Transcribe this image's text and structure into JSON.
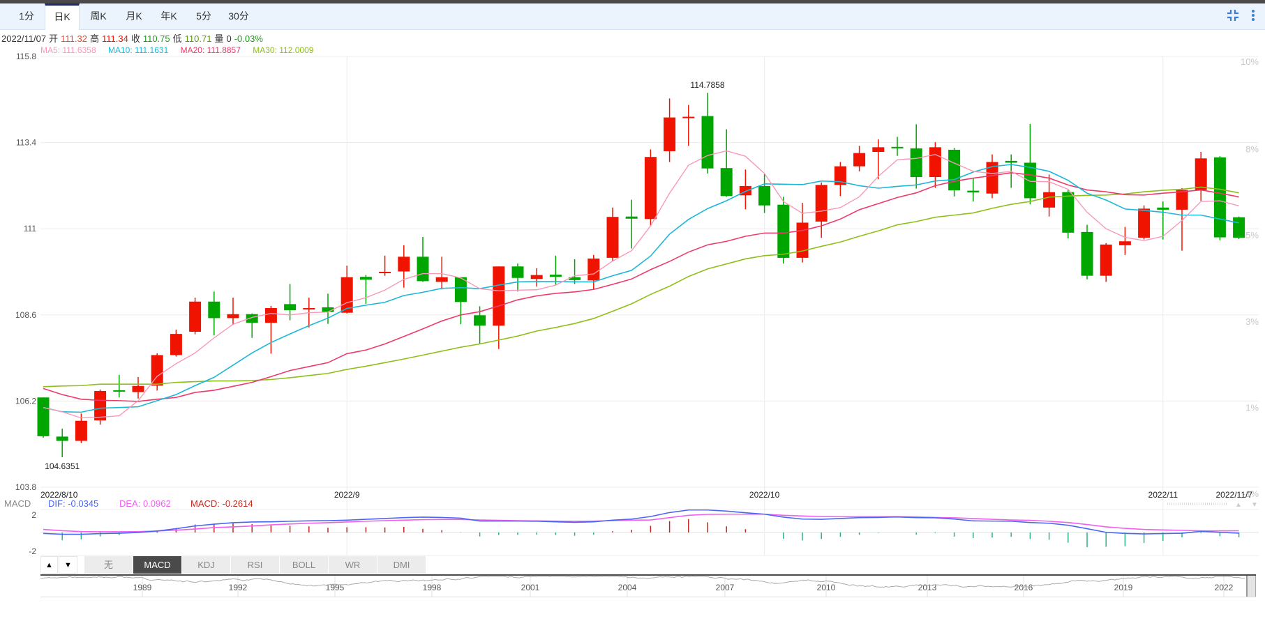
{
  "tabs": [
    {
      "label": "1分"
    },
    {
      "label": "日K",
      "active": true
    },
    {
      "label": "周K"
    },
    {
      "label": "月K"
    },
    {
      "label": "年K"
    },
    {
      "label": "5分"
    },
    {
      "label": "30分"
    }
  ],
  "toolbar": {
    "collapse_icon": "compress-icon",
    "more_icon": "more-vertical-icon"
  },
  "info": {
    "date": "2022/11/07",
    "open_label": "开",
    "open": "111.32",
    "high_label": "高",
    "high": "111.34",
    "close_label": "收",
    "close": "110.75",
    "low_label": "低",
    "low": "110.71",
    "volume_label": "量",
    "volume": "0",
    "change": "-0.03%"
  },
  "ma_legend": {
    "ma5": "MA5: 111.6358",
    "ma10": "MA10: 111.1631",
    "ma20": "MA20: 111.8857",
    "ma30": "MA30: 112.0009"
  },
  "macd_legend": {
    "title": "MACD",
    "dif": "DIF: -0.0345",
    "dea": "DEA: 0.0962",
    "macd": "MACD: -0.2614"
  },
  "indicator_tabs": [
    {
      "label": "无"
    },
    {
      "label": "MACD",
      "active": true
    },
    {
      "label": "KDJ"
    },
    {
      "label": "RSI"
    },
    {
      "label": "BOLL"
    },
    {
      "label": "WR"
    },
    {
      "label": "DMI"
    }
  ],
  "indicator_arrows": {
    "up": "▲",
    "down": "▼"
  },
  "navigator": {
    "years": [
      "1989",
      "1992",
      "1995",
      "1998",
      "2001",
      "2004",
      "2007",
      "2010",
      "2013",
      "2016",
      "2019",
      "2022"
    ]
  },
  "colors": {
    "up": "#f01400",
    "down": "#00a600",
    "ma5": "#f799b8",
    "ma10": "#1ab8d8",
    "ma20": "#ee3a6a",
    "ma30": "#8fbf1a",
    "dif": "#4a66f5",
    "dea": "#f060f0",
    "hist_up": "#c0281e",
    "hist_down": "#2ab38a"
  },
  "chart_data": {
    "type": "candlestick",
    "price_axis": {
      "ticks": [
        "115.8",
        "113.4",
        "111",
        "108.6",
        "106.2",
        "103.8"
      ],
      "range": [
        103.8,
        115.8
      ]
    },
    "percent_axis": {
      "ticks": [
        "10%",
        "8%",
        "5%",
        "3%",
        "1%",
        "-1%"
      ]
    },
    "date_labels": [
      {
        "text": "2022/8/10",
        "index": 0
      },
      {
        "text": "2022/9",
        "index": 16
      },
      {
        "text": "2022/10",
        "index": 38
      },
      {
        "text": "2022/11",
        "index": 59
      },
      {
        "text": "2022/11/7",
        "index": 63
      }
    ],
    "annotations": [
      {
        "text": "104.6351",
        "index": 1,
        "pos": "below"
      },
      {
        "text": "114.7858",
        "index": 35,
        "pos": "above"
      }
    ],
    "ohlc": [
      [
        106.3,
        106.3,
        105.18,
        105.22
      ],
      [
        105.21,
        105.43,
        104.6351,
        105.09
      ],
      [
        105.09,
        105.85,
        105.03,
        105.65
      ],
      [
        105.66,
        106.52,
        105.54,
        106.48
      ],
      [
        106.5,
        106.93,
        106.3,
        106.47
      ],
      [
        106.45,
        106.87,
        106.27,
        106.62
      ],
      [
        106.63,
        107.53,
        106.49,
        107.48
      ],
      [
        107.48,
        108.19,
        107.44,
        108.07
      ],
      [
        108.13,
        109.08,
        108.06,
        108.97
      ],
      [
        108.97,
        109.25,
        108.03,
        108.51
      ],
      [
        108.51,
        109.08,
        108.32,
        108.62
      ],
      [
        108.62,
        108.64,
        107.96,
        108.38
      ],
      [
        108.38,
        108.85,
        107.52,
        108.79
      ],
      [
        108.9,
        109.46,
        108.45,
        108.73
      ],
      [
        108.75,
        109.08,
        108.25,
        108.79
      ],
      [
        108.81,
        109.19,
        108.35,
        108.68
      ],
      [
        108.66,
        109.97,
        108.64,
        109.65
      ],
      [
        109.66,
        109.71,
        108.91,
        109.58
      ],
      [
        109.78,
        110.25,
        109.69,
        109.8
      ],
      [
        109.81,
        110.54,
        109.36,
        110.22
      ],
      [
        110.22,
        110.77,
        109.52,
        109.54
      ],
      [
        109.52,
        110.22,
        109.31,
        109.65
      ],
      [
        109.65,
        109.65,
        108.34,
        108.96
      ],
      [
        108.59,
        108.84,
        107.79,
        108.3
      ],
      [
        108.3,
        109.95,
        107.65,
        109.95
      ],
      [
        109.95,
        110.03,
        109.25,
        109.63
      ],
      [
        109.6,
        109.9,
        109.39,
        109.71
      ],
      [
        109.72,
        110.25,
        109.44,
        109.66
      ],
      [
        109.65,
        110.15,
        109.46,
        109.57
      ],
      [
        109.56,
        110.27,
        109.31,
        110.17
      ],
      [
        110.19,
        111.59,
        110.1,
        111.33
      ],
      [
        111.34,
        111.81,
        110.45,
        111.28
      ],
      [
        111.27,
        113.21,
        111.08,
        113.0
      ],
      [
        113.16,
        114.63,
        112.86,
        114.1
      ],
      [
        114.1,
        114.45,
        113.31,
        114.12
      ],
      [
        114.14,
        114.7858,
        112.54,
        112.68
      ],
      [
        112.69,
        113.77,
        111.89,
        111.91
      ],
      [
        111.93,
        112.65,
        111.54,
        112.19
      ],
      [
        112.19,
        112.52,
        111.44,
        111.65
      ],
      [
        111.67,
        111.89,
        110.03,
        110.19
      ],
      [
        110.19,
        111.72,
        110.06,
        111.17
      ],
      [
        111.2,
        112.29,
        110.75,
        112.22
      ],
      [
        112.22,
        112.86,
        111.91,
        112.74
      ],
      [
        112.74,
        113.31,
        112.6,
        113.11
      ],
      [
        113.14,
        113.49,
        112.38,
        113.27
      ],
      [
        113.28,
        113.56,
        113.03,
        113.25
      ],
      [
        113.24,
        113.91,
        112.12,
        112.44
      ],
      [
        112.44,
        113.41,
        112.14,
        113.27
      ],
      [
        113.2,
        113.25,
        111.9,
        112.07
      ],
      [
        112.06,
        112.41,
        111.76,
        112.01
      ],
      [
        111.98,
        113.07,
        111.85,
        112.86
      ],
      [
        112.89,
        113.07,
        112.14,
        112.84
      ],
      [
        112.84,
        113.92,
        111.68,
        111.85
      ],
      [
        111.59,
        112.51,
        111.34,
        112.02
      ],
      [
        112.02,
        112.08,
        110.73,
        110.89
      ],
      [
        110.91,
        111.11,
        109.59,
        109.69
      ],
      [
        109.69,
        110.6,
        109.52,
        110.56
      ],
      [
        110.54,
        111.05,
        110.27,
        110.65
      ],
      [
        110.75,
        111.65,
        110.7,
        111.56
      ],
      [
        111.59,
        111.76,
        110.7,
        111.53
      ],
      [
        111.53,
        112.13,
        110.39,
        112.08
      ],
      [
        112.08,
        113.14,
        111.78,
        112.96
      ],
      [
        112.99,
        113.02,
        110.68,
        110.76
      ],
      [
        111.32,
        111.34,
        110.71,
        110.75
      ]
    ],
    "ma5": [
      106.02,
      105.9,
      105.73,
      105.75,
      105.79,
      106.21,
      106.89,
      107.24,
      107.54,
      107.96,
      108.34,
      108.53,
      108.64,
      108.6,
      108.66,
      108.68,
      108.94,
      109.08,
      109.29,
      109.59,
      109.75,
      109.75,
      109.63,
      109.33,
      109.27,
      109.29,
      109.3,
      109.43,
      109.69,
      109.74,
      110.1,
      110.39,
      111.08,
      111.99,
      112.77,
      113.04,
      113.17,
      113.02,
      112.54,
      111.76,
      111.43,
      111.49,
      111.59,
      111.89,
      112.46,
      112.92,
      112.96,
      113.07,
      112.83,
      112.6,
      112.54,
      112.6,
      112.32,
      112.31,
      112.1,
      111.46,
      111.0,
      110.76,
      110.67,
      110.79,
      111.23,
      111.76,
      111.78,
      111.6358
    ],
    "ma10": [
      106.02,
      105.9,
      105.89,
      106.0,
      106.02,
      106.04,
      106.21,
      106.38,
      106.63,
      106.86,
      107.2,
      107.54,
      107.83,
      108.07,
      108.3,
      108.51,
      108.78,
      108.87,
      108.95,
      109.14,
      109.23,
      109.34,
      109.36,
      109.33,
      109.43,
      109.52,
      109.53,
      109.53,
      109.52,
      109.52,
      109.69,
      109.84,
      110.24,
      110.85,
      111.26,
      111.56,
      111.78,
      112.04,
      112.25,
      112.24,
      112.23,
      112.33,
      112.31,
      112.2,
      112.13,
      112.18,
      112.22,
      112.33,
      112.37,
      112.58,
      112.73,
      112.79,
      112.71,
      112.6,
      112.35,
      111.99,
      111.8,
      111.55,
      111.51,
      111.46,
      111.38,
      111.38,
      111.27,
      111.1631
    ],
    "ma20": [
      106.55,
      106.38,
      106.25,
      106.22,
      106.21,
      106.19,
      106.25,
      106.3,
      106.44,
      106.5,
      106.61,
      106.72,
      106.88,
      107.05,
      107.16,
      107.27,
      107.52,
      107.62,
      107.79,
      108.0,
      108.21,
      108.43,
      108.6,
      108.69,
      108.85,
      109.02,
      109.13,
      109.2,
      109.24,
      109.31,
      109.45,
      109.6,
      109.86,
      110.09,
      110.35,
      110.55,
      110.65,
      110.79,
      110.88,
      110.88,
      110.95,
      111.08,
      111.27,
      111.53,
      111.7,
      111.87,
      112.0,
      112.2,
      112.32,
      112.41,
      112.48,
      112.56,
      112.5,
      112.41,
      112.22,
      112.08,
      112.03,
      111.95,
      111.94,
      111.99,
      112.03,
      112.08,
      111.99,
      111.8857
    ],
    "ma30": [
      106.6,
      106.62,
      106.63,
      106.67,
      106.67,
      106.67,
      106.67,
      106.72,
      106.74,
      106.76,
      106.76,
      106.77,
      106.8,
      106.85,
      106.91,
      106.97,
      107.08,
      107.17,
      107.27,
      107.37,
      107.48,
      107.59,
      107.7,
      107.79,
      107.9,
      108.01,
      108.15,
      108.25,
      108.36,
      108.5,
      108.7,
      108.91,
      109.17,
      109.4,
      109.67,
      109.88,
      110.02,
      110.16,
      110.25,
      110.29,
      110.38,
      110.51,
      110.63,
      110.79,
      110.94,
      111.11,
      111.2,
      111.32,
      111.38,
      111.44,
      111.57,
      111.68,
      111.76,
      111.88,
      111.91,
      111.93,
      111.94,
      111.97,
      112.03,
      112.07,
      112.1,
      112.16,
      112.1,
      112.0009
    ],
    "macd": {
      "axis_ticks": [
        "2",
        "-2"
      ],
      "dif": [
        -0.05,
        -0.1,
        -0.1,
        -0.06,
        -0.04,
        0,
        0.08,
        0.21,
        0.36,
        0.46,
        0.54,
        0.58,
        0.59,
        0.62,
        0.64,
        0.65,
        0.68,
        0.73,
        0.77,
        0.82,
        0.85,
        0.83,
        0.79,
        0.63,
        0.63,
        0.63,
        0.62,
        0.59,
        0.56,
        0.59,
        0.68,
        0.74,
        0.88,
        1.1,
        1.24,
        1.24,
        1.18,
        1.09,
        1.01,
        0.85,
        0.74,
        0.73,
        0.77,
        0.82,
        0.83,
        0.86,
        0.82,
        0.81,
        0.74,
        0.64,
        0.63,
        0.62,
        0.55,
        0.51,
        0.4,
        0.21,
        0.01,
        -0.05,
        -0.08,
        -0.06,
        -0.04,
        0.06,
        0.01,
        -0.0345
      ],
      "dea": [
        0.17,
        0.1,
        0.05,
        0.04,
        0.04,
        0.05,
        0.08,
        0.13,
        0.19,
        0.27,
        0.31,
        0.36,
        0.42,
        0.47,
        0.51,
        0.54,
        0.58,
        0.62,
        0.65,
        0.68,
        0.71,
        0.72,
        0.72,
        0.69,
        0.67,
        0.65,
        0.64,
        0.63,
        0.62,
        0.63,
        0.65,
        0.68,
        0.69,
        0.82,
        0.95,
        1.0,
        1.01,
        1.01,
        1.01,
        0.95,
        0.91,
        0.88,
        0.87,
        0.87,
        0.87,
        0.87,
        0.86,
        0.83,
        0.81,
        0.77,
        0.73,
        0.69,
        0.67,
        0.62,
        0.55,
        0.44,
        0.31,
        0.23,
        0.17,
        0.14,
        0.12,
        0.09,
        0.09,
        0.0962
      ],
      "hist": [
        0,
        -0.43,
        -0.38,
        -0.22,
        -0.15,
        -0.03,
        0.12,
        0.24,
        0.44,
        0.49,
        0.51,
        0.46,
        0.41,
        0.37,
        0.34,
        0.26,
        0.29,
        0.29,
        0.28,
        0.31,
        0.2,
        0.13,
        0.01,
        -0.22,
        -0.14,
        -0.13,
        -0.12,
        -0.14,
        -0.18,
        -0.12,
        0.07,
        0.15,
        0.37,
        0.63,
        0.74,
        0.56,
        0.34,
        0.18,
        0,
        -0.35,
        -0.44,
        -0.36,
        -0.24,
        -0.13,
        -0.02,
        0,
        -0.12,
        -0.04,
        -0.23,
        -0.31,
        -0.28,
        -0.24,
        -0.36,
        -0.4,
        -0.56,
        -0.81,
        -0.79,
        -0.76,
        -0.58,
        -0.46,
        -0.27,
        -0.04,
        -0.21,
        -0.2614
      ]
    }
  }
}
